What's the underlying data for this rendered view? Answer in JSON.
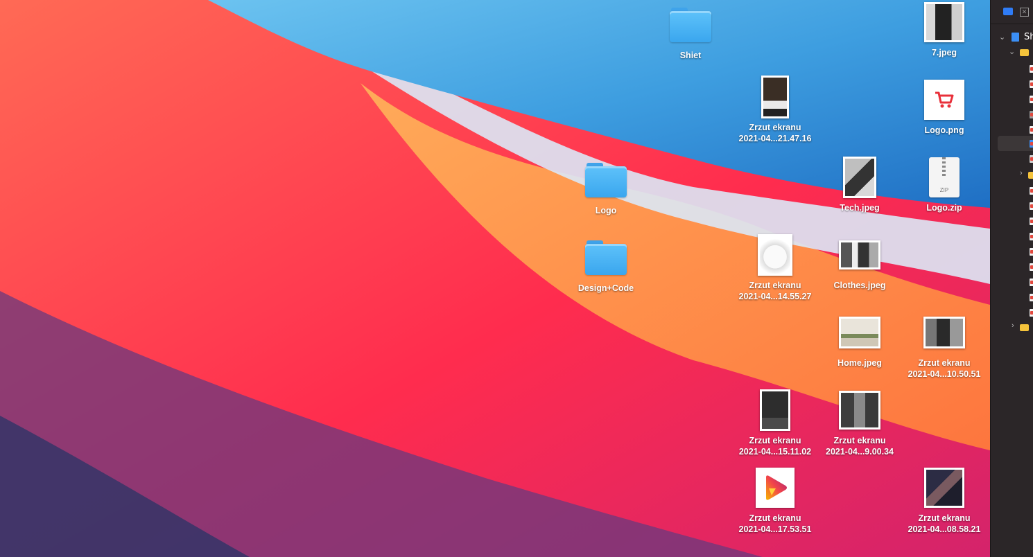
{
  "desktop": {
    "icons": [
      {
        "name": "Shiet",
        "kind": "folder"
      },
      {
        "name": "7.jpeg",
        "kind": "photo"
      },
      {
        "name": "Zrzut ekranu 2021-04...21.47.16",
        "line1": "Zrzut ekranu",
        "line2": "2021-04...21.47.16",
        "kind": "photo"
      },
      {
        "name": "Logo.png",
        "kind": "logo-png"
      },
      {
        "name": "Logo",
        "kind": "folder"
      },
      {
        "name": "Tech.jpeg",
        "kind": "photo"
      },
      {
        "name": "Logo.zip",
        "kind": "zip"
      },
      {
        "name": "Design+Code",
        "kind": "folder"
      },
      {
        "name": "Zrzut ekranu 2021-04...14.55.27",
        "line1": "Zrzut ekranu",
        "line2": "2021-04...14.55.27",
        "kind": "photo"
      },
      {
        "name": "Clothes.jpeg",
        "kind": "photo"
      },
      {
        "name": "Home.jpeg",
        "kind": "photo"
      },
      {
        "name": "Zrzut ekranu 2021-04...10.50.51",
        "line1": "Zrzut ekranu",
        "line2": "2021-04...10.50.51",
        "kind": "photo"
      },
      {
        "name": "Zrzut ekranu 2021-04...15.11.02",
        "line1": "Zrzut ekranu",
        "line2": "2021-04...15.11.02",
        "kind": "photo"
      },
      {
        "name": "Zrzut ekranu 2021-04...9.00.34",
        "line1": "Zrzut ekranu",
        "line2": "2021-04...9.00.34",
        "kind": "photo"
      },
      {
        "name": "Zrzut ekranu 2021-04...17.53.51",
        "line1": "Zrzut ekranu",
        "line2": "2021-04...17.53.51",
        "kind": "app-logo"
      },
      {
        "name": "Zrzut ekranu 2021-04...08.58.21",
        "line1": "Zrzut ekranu",
        "line2": "2021-04...08.58.21",
        "kind": "photo"
      }
    ],
    "zip_badge": "ZIP"
  },
  "sidebar": {
    "title": "Sh",
    "close_glyph": "✕"
  },
  "colors": {
    "folder_blue": "#4fb6f6",
    "sidebar_bg": "#2b2628",
    "accent": "#2f7cf6"
  }
}
